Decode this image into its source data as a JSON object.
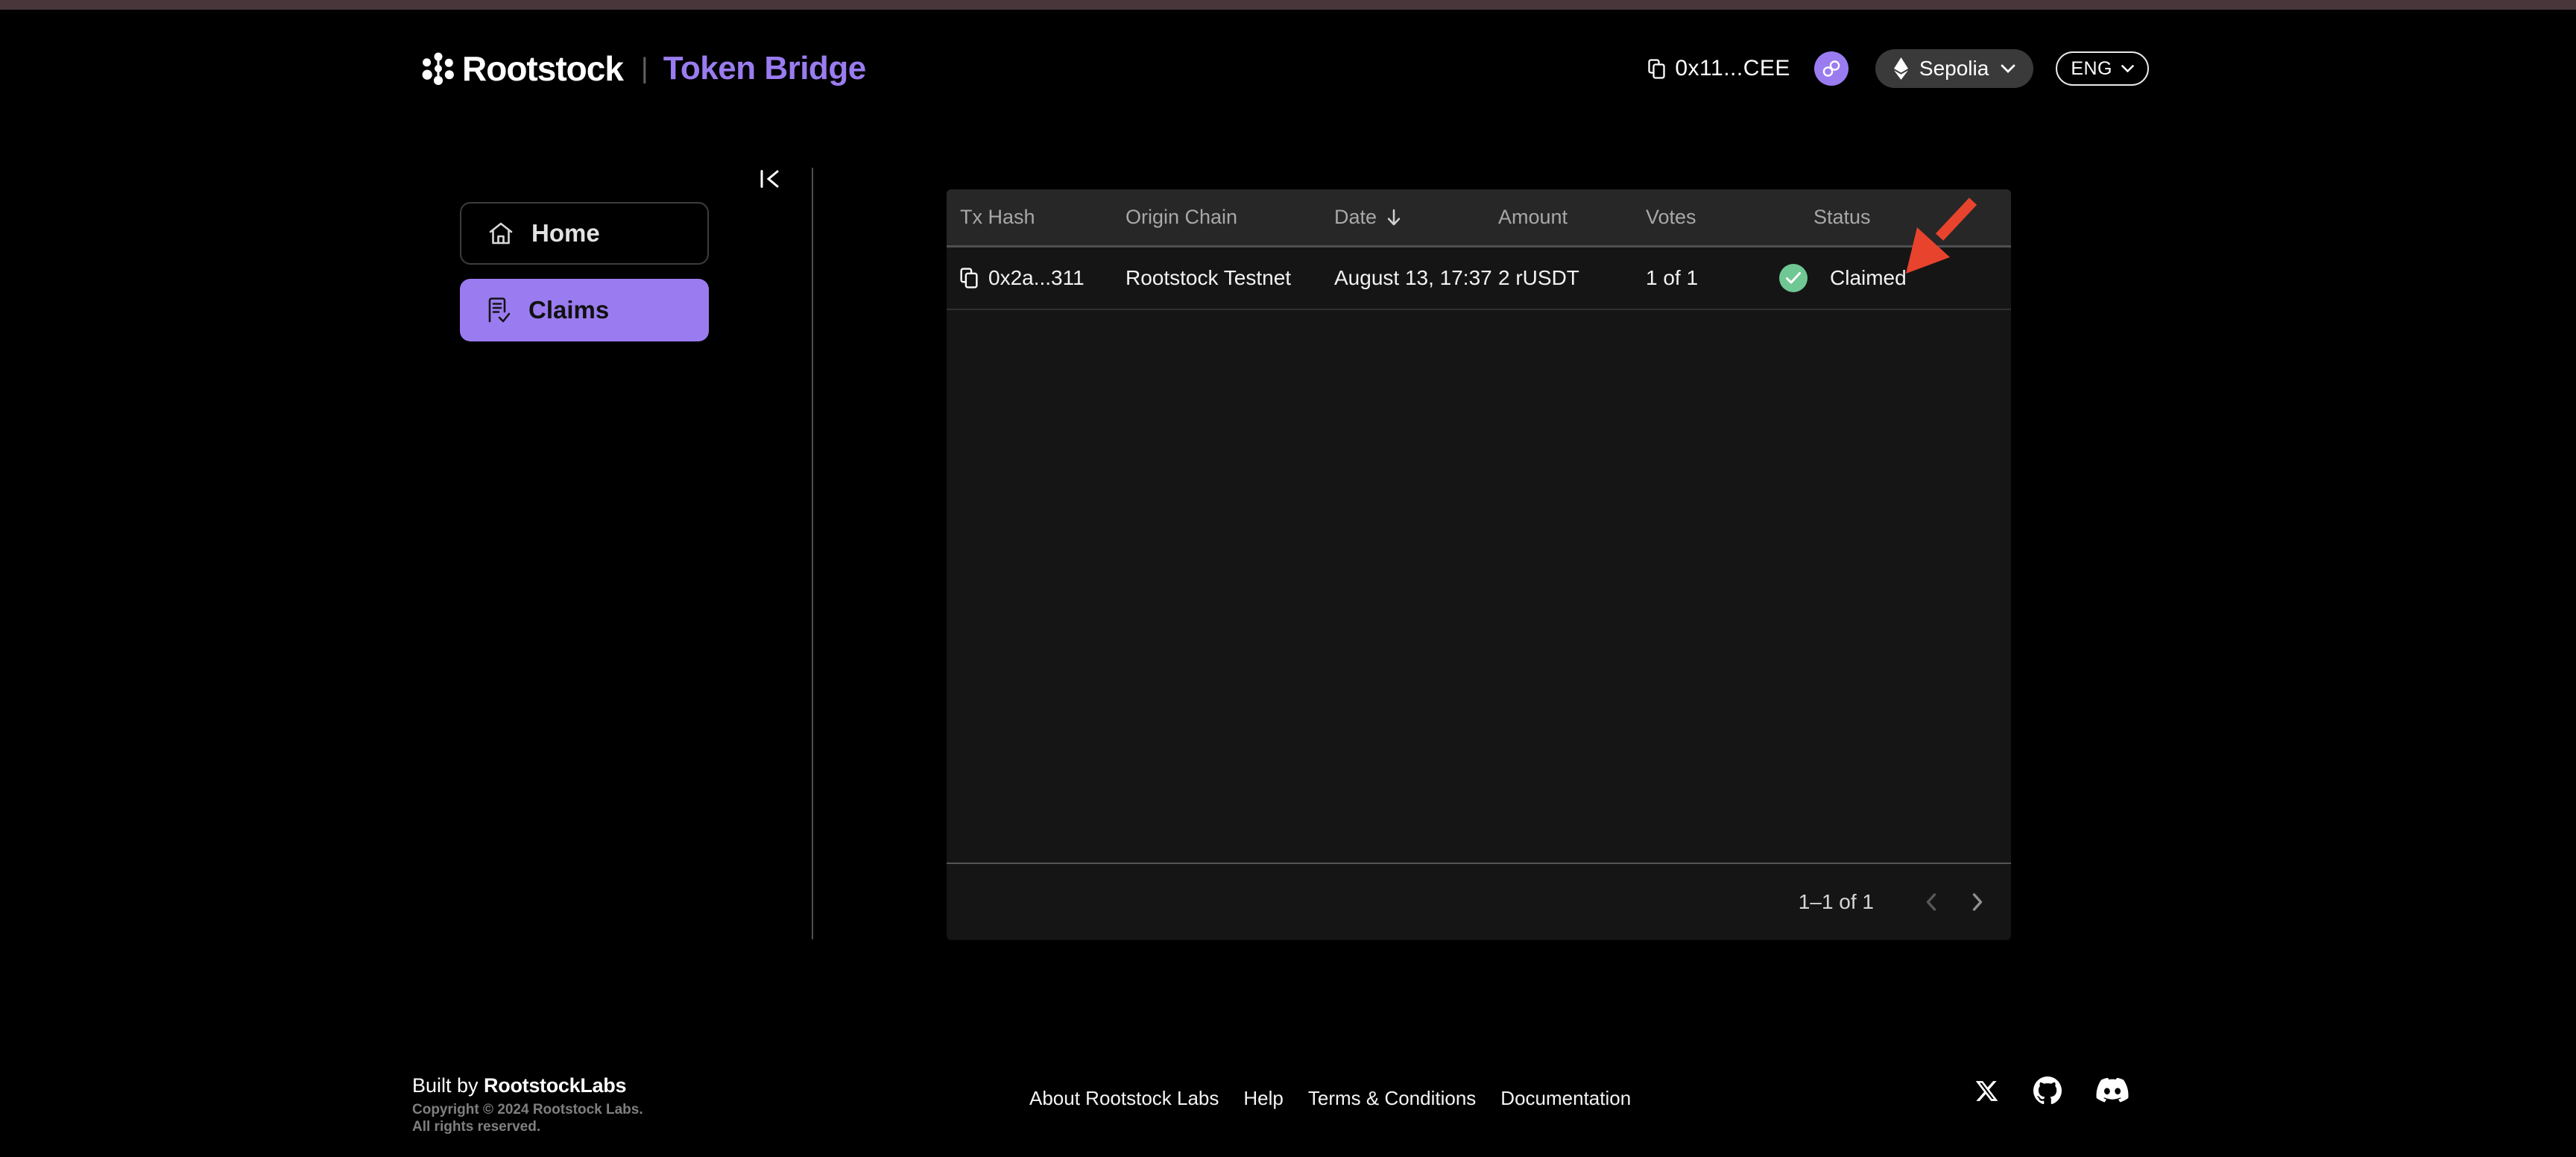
{
  "header": {
    "brand": {
      "name": "Rootstock",
      "separator": "|",
      "product": "Token Bridge"
    },
    "wallet": {
      "address": "0x11...CEE"
    },
    "network": {
      "label": "Sepolia"
    },
    "language": {
      "label": "ENG"
    }
  },
  "sidebar": {
    "items": [
      {
        "label": "Home",
        "icon": "home-icon",
        "active": false
      },
      {
        "label": "Claims",
        "icon": "claims-document-check-icon",
        "active": true
      }
    ]
  },
  "table": {
    "columns": {
      "tx_hash": "Tx Hash",
      "origin_chain": "Origin Chain",
      "date": "Date",
      "amount": "Amount",
      "votes": "Votes",
      "status": "Status"
    },
    "sort": {
      "column": "date",
      "direction": "desc"
    },
    "rows": [
      {
        "tx_hash": "0x2a...311",
        "origin_chain": "Rootstock Testnet",
        "date": "August 13, 17:37",
        "amount": "2 rUSDT",
        "votes": "1 of 1",
        "status": "Claimed"
      }
    ],
    "pagination": {
      "label": "1–1 of 1"
    }
  },
  "annotation": {
    "type": "arrow",
    "color": "#e8432d",
    "points_at": "Claimed status"
  },
  "footer": {
    "built_by_prefix": "Built by ",
    "built_by_brand": "RootstockLabs",
    "copyright_line1": "Copyright © 2024 Rootstock Labs.",
    "copyright_line2": "All rights reserved.",
    "links": [
      "About Rootstock Labs",
      "Help",
      "Terms & Conditions",
      "Documentation"
    ],
    "social": [
      "x-icon",
      "github-icon",
      "discord-icon"
    ]
  },
  "colors": {
    "accent_purple": "#9a7cf0",
    "status_green": "#6fc793",
    "annotation_red": "#e8432d",
    "panel_bg": "#151515",
    "panel_header_bg": "#272727",
    "top_strip": "#48363a"
  }
}
